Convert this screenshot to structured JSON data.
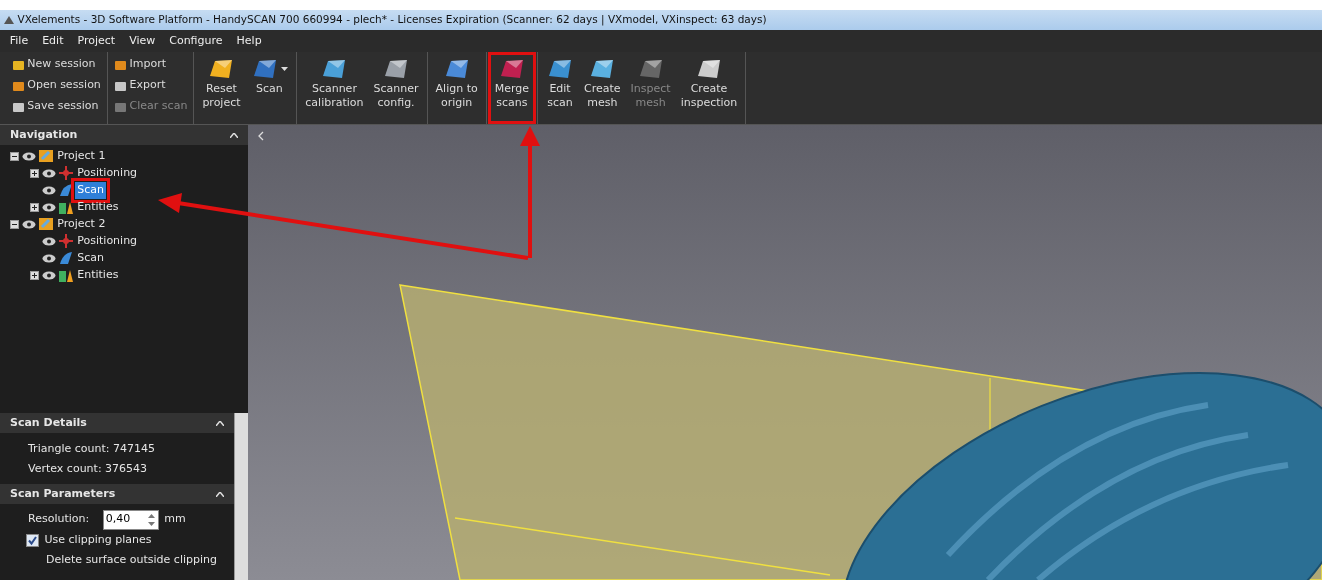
{
  "window": {
    "title": "VXelements - 3D Software Platform - HandySCAN 700 660994 - plech* - Licenses Expiration (Scanner: 62 days | VXmodel, VXinspect: 63 days)"
  },
  "menu": [
    "File",
    "Edit",
    "Project",
    "View",
    "Configure",
    "Help"
  ],
  "toolbar": {
    "small_groups": [
      [
        {
          "label": "New session",
          "disabled": false
        },
        {
          "label": "Open session",
          "disabled": false
        },
        {
          "label": "Save session",
          "disabled": false
        }
      ],
      [
        {
          "label": "Import",
          "disabled": false
        },
        {
          "label": "Export",
          "disabled": false
        },
        {
          "label": "Clear scan",
          "disabled": true
        }
      ]
    ],
    "groups": [
      [
        {
          "label": "Reset\nproject",
          "disabled": false,
          "highlighted": false,
          "dropdown": false
        },
        {
          "label": "Scan",
          "disabled": false,
          "highlighted": false,
          "dropdown": true
        }
      ],
      [
        {
          "label": "Scanner\ncalibration",
          "disabled": false,
          "highlighted": false,
          "dropdown": false
        },
        {
          "label": "Scanner\nconfig.",
          "disabled": false,
          "highlighted": false,
          "dropdown": false
        }
      ],
      [
        {
          "label": "Align to\norigin",
          "disabled": false,
          "highlighted": false,
          "dropdown": false
        }
      ],
      [
        {
          "label": "Merge\nscans",
          "disabled": false,
          "highlighted": true,
          "dropdown": false
        }
      ],
      [
        {
          "label": "Edit\nscan",
          "disabled": false,
          "highlighted": false,
          "dropdown": false
        },
        {
          "label": "Create\nmesh",
          "disabled": false,
          "highlighted": false,
          "dropdown": false
        },
        {
          "label": "Inspect\nmesh",
          "disabled": true,
          "highlighted": false,
          "dropdown": false
        },
        {
          "label": "Create\ninspection",
          "disabled": false,
          "highlighted": false,
          "dropdown": false
        }
      ]
    ]
  },
  "navigation": {
    "title": "Navigation",
    "tree": [
      {
        "label": "Project 1",
        "kind": "project",
        "expanded": true,
        "selected": false,
        "highlighted": false,
        "children": [
          {
            "label": "Positioning",
            "kind": "positioning",
            "expanded": false,
            "selected": false,
            "highlighted": false
          },
          {
            "label": "Scan",
            "kind": "scan",
            "selected": true,
            "highlighted": true
          },
          {
            "label": "Entities",
            "kind": "entities",
            "expanded": false,
            "selected": false,
            "highlighted": false
          }
        ]
      },
      {
        "label": "Project 2",
        "kind": "project",
        "expanded": true,
        "selected": false,
        "highlighted": false,
        "children": [
          {
            "label": "Positioning",
            "kind": "positioning",
            "selected": false,
            "highlighted": false
          },
          {
            "label": "Scan",
            "kind": "scan",
            "selected": false,
            "highlighted": false
          },
          {
            "label": "Entities",
            "kind": "entities",
            "expanded": false,
            "selected": false,
            "highlighted": false
          }
        ]
      }
    ]
  },
  "scan_details": {
    "title": "Scan Details",
    "lines": [
      "Triangle count: 747145",
      "Vertex count: 376543"
    ]
  },
  "scan_parameters": {
    "title": "Scan Parameters",
    "resolution_label": "Resolution:",
    "resolution_value": "0,40",
    "unit": "mm",
    "use_clipping": {
      "label": "Use clipping planes",
      "checked": true
    },
    "cut_text": "Delete surface outside clipping"
  }
}
